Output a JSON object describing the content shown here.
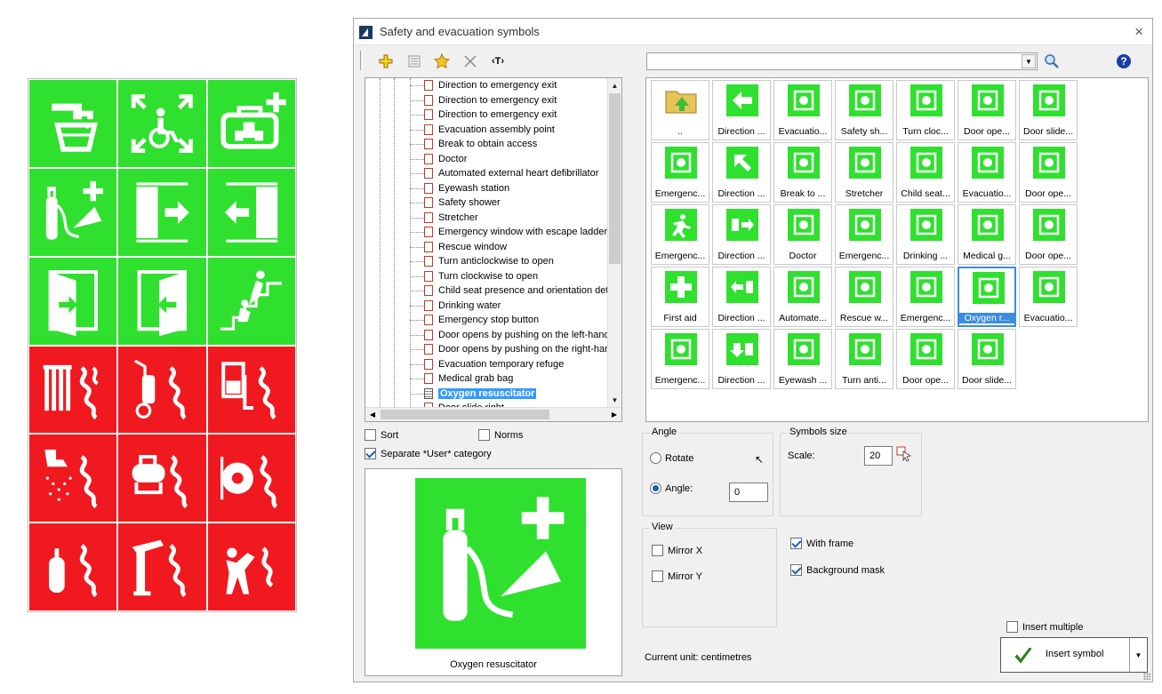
{
  "window": {
    "title": "Safety and evacuation symbols",
    "close_glyph": "×"
  },
  "toolbar": {
    "search_value": "",
    "help_glyph": "?",
    "text_tool_glyph": "‹T›"
  },
  "tree": {
    "items": [
      "Direction to emergency exit",
      "Direction to emergency exit",
      "Direction to emergency exit",
      "Evacuation assembly point",
      "Break to obtain access",
      "Doctor",
      "Automated external heart defibrillator",
      "Eyewash station",
      "Safety shower",
      "Stretcher",
      "Emergency window with escape ladder",
      "Rescue window",
      "Turn anticlockwise to open",
      "Turn clockwise to open",
      "Child seat presence and orientation detec",
      "Drinking water",
      "Emergency stop button",
      "Door opens by pushing on the left-hand si",
      "Door opens by pushing on the right-hand",
      "Evacuation temporary refuge",
      "Medical grab bag",
      "Oxygen resuscitator",
      "Door slide right..."
    ],
    "selected": "Oxygen resuscitator"
  },
  "symbols": [
    {
      "caption": "..",
      "kind": "folder"
    },
    {
      "caption": "Direction ...",
      "icon": "arrow-left-icon"
    },
    {
      "caption": "Evacuatio...",
      "icon": "assembly-point-icon"
    },
    {
      "caption": "Safety sh...",
      "icon": "safety-shower-icon"
    },
    {
      "caption": "Turn cloc...",
      "icon": "turn-clockwise-icon"
    },
    {
      "caption": "Door ope...",
      "icon": "door-open-icon"
    },
    {
      "caption": "Door slide...",
      "icon": "door-slide-left-icon"
    },
    {
      "caption": "Emergenc...",
      "icon": "emergency-exit-icon"
    },
    {
      "caption": "Direction ...",
      "icon": "arrow-diagonal-icon"
    },
    {
      "caption": "Break to ...",
      "icon": "break-glass-icon"
    },
    {
      "caption": "Stretcher",
      "icon": "stretcher-icon"
    },
    {
      "caption": "Child seat...",
      "icon": "child-seat-icon"
    },
    {
      "caption": "Evacuatio...",
      "icon": "wheelchair-evacuation-icon"
    },
    {
      "caption": "Door ope...",
      "icon": "door-open-right-icon"
    },
    {
      "caption": "Emergenc...",
      "icon": "running-man-icon"
    },
    {
      "caption": "Direction ...",
      "icon": "exit-right-arrow-icon"
    },
    {
      "caption": "Doctor",
      "icon": "doctor-icon"
    },
    {
      "caption": "Emergenc...",
      "icon": "escape-ladder-icon"
    },
    {
      "caption": "Drinking ...",
      "icon": "drinking-water-icon"
    },
    {
      "caption": "Medical g...",
      "icon": "medical-bag-icon"
    },
    {
      "caption": "Door ope...",
      "icon": "door-open-left-icon"
    },
    {
      "caption": "First aid",
      "icon": "first-aid-cross-icon"
    },
    {
      "caption": "Direction ...",
      "icon": "exit-left-arrow-icon"
    },
    {
      "caption": "Automate...",
      "icon": "defibrillator-icon"
    },
    {
      "caption": "Rescue w...",
      "icon": "rescue-window-icon"
    },
    {
      "caption": "Emergenc...",
      "icon": "emergency-stop-icon"
    },
    {
      "caption": "Oxygen r...",
      "icon": "oxygen-icon",
      "selected": true
    },
    {
      "caption": "Evacuatio...",
      "icon": "evacuation-chair-icon"
    },
    {
      "caption": "Emergenc...",
      "icon": "emergency-phone-icon"
    },
    {
      "caption": "Direction ...",
      "icon": "exit-down-arrow-icon"
    },
    {
      "caption": "Eyewash ...",
      "icon": "eyewash-icon"
    },
    {
      "caption": "Turn anti...",
      "icon": "turn-anticlockwise-icon"
    },
    {
      "caption": "Door ope...",
      "icon": "door-open-push-icon"
    },
    {
      "caption": "Door slide...",
      "icon": "door-slide-right-icon"
    }
  ],
  "options": {
    "sort_label": "Sort",
    "sort_checked": false,
    "norms_label": "Norms",
    "norms_checked": false,
    "separate_user_label": "Separate *User* category",
    "separate_user_checked": true
  },
  "preview": {
    "caption": "Oxygen resuscitator"
  },
  "angle": {
    "group_title": "Angle",
    "rotate_label": "Rotate",
    "angle_label": "Angle:",
    "angle_value": "0",
    "selected_mode": "Angle"
  },
  "size": {
    "group_title": "Symbols size",
    "scale_label": "Scale:",
    "scale_value": "20"
  },
  "view": {
    "group_title": "View",
    "mirror_x_label": "Mirror X",
    "mirror_x_checked": false,
    "mirror_y_label": "Mirror Y",
    "mirror_y_checked": false
  },
  "frame": {
    "with_frame_label": "With frame",
    "with_frame_checked": true,
    "background_mask_label": "Background mask",
    "background_mask_checked": true
  },
  "insert": {
    "multiple_label": "Insert multiple",
    "multiple_checked": false,
    "button_label": "Insert symbol"
  },
  "status": {
    "current_unit": "Current unit: centimetres"
  },
  "colors": {
    "safety_green": "#2fe02f",
    "fire_red": "#f0191f",
    "selection_blue": "#3399ff"
  }
}
